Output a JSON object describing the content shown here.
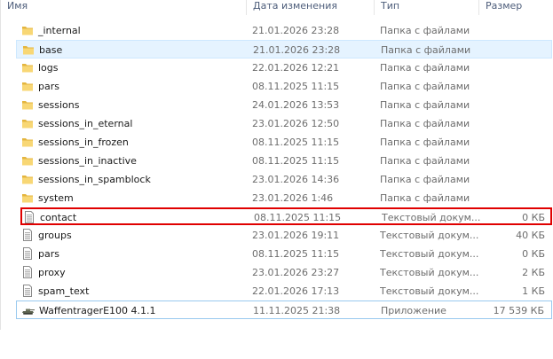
{
  "columns": {
    "name": "Имя",
    "date": "Дата изменения",
    "type": "Тип",
    "size": "Размер"
  },
  "rows": [
    {
      "name": "_internal",
      "date": "21.01.2026 23:28",
      "type": "Папка с файлами",
      "size": "",
      "icon": "folder-icon",
      "state": "normal"
    },
    {
      "name": "base",
      "date": "21.01.2026 23:28",
      "type": "Папка с файлами",
      "size": "",
      "icon": "folder-icon",
      "state": "selected"
    },
    {
      "name": "logs",
      "date": "22.01.2026 12:21",
      "type": "Папка с файлами",
      "size": "",
      "icon": "folder-icon",
      "state": "normal"
    },
    {
      "name": "pars",
      "date": "08.11.2025 11:15",
      "type": "Папка с файлами",
      "size": "",
      "icon": "folder-icon",
      "state": "normal"
    },
    {
      "name": "sessions",
      "date": "24.01.2026 13:53",
      "type": "Папка с файлами",
      "size": "",
      "icon": "folder-icon",
      "state": "normal"
    },
    {
      "name": "sessions_in_eternal",
      "date": "23.01.2026 12:50",
      "type": "Папка с файлами",
      "size": "",
      "icon": "folder-icon",
      "state": "normal"
    },
    {
      "name": "sessions_in_frozen",
      "date": "08.11.2025 11:15",
      "type": "Папка с файлами",
      "size": "",
      "icon": "folder-icon",
      "state": "normal"
    },
    {
      "name": "sessions_in_inactive",
      "date": "08.11.2025 11:15",
      "type": "Папка с файлами",
      "size": "",
      "icon": "folder-icon",
      "state": "normal"
    },
    {
      "name": "sessions_in_spamblock",
      "date": "23.01.2026 14:36",
      "type": "Папка с файлами",
      "size": "",
      "icon": "folder-icon",
      "state": "normal"
    },
    {
      "name": "system",
      "date": "23.01.2026 1:46",
      "type": "Папка с файлами",
      "size": "",
      "icon": "folder-icon",
      "state": "normal"
    },
    {
      "name": "contact",
      "date": "08.11.2025 11:15",
      "type": "Текстовый докум...",
      "size": "0 КБ",
      "icon": "text-file-icon",
      "state": "highlight"
    },
    {
      "name": "groups",
      "date": "23.01.2026 19:11",
      "type": "Текстовый докум...",
      "size": "40 КБ",
      "icon": "text-file-icon",
      "state": "normal"
    },
    {
      "name": "pars",
      "date": "08.11.2025 11:15",
      "type": "Текстовый докум...",
      "size": "0 КБ",
      "icon": "text-file-icon",
      "state": "normal"
    },
    {
      "name": "proxy",
      "date": "23.01.2026 23:27",
      "type": "Текстовый докум...",
      "size": "2 КБ",
      "icon": "text-file-icon",
      "state": "normal"
    },
    {
      "name": "spam_text",
      "date": "22.01.2026 17:13",
      "type": "Текстовый докум...",
      "size": "1 КБ",
      "icon": "text-file-icon",
      "state": "normal"
    },
    {
      "name": "WaffentragerE100 4.1.1",
      "date": "11.11.2025 21:38",
      "type": "Приложение",
      "size": "17 539 КБ",
      "icon": "tank-app-icon",
      "state": "app"
    }
  ],
  "colors": {
    "folder": "#f8d775",
    "folder_dark": "#e4b53e",
    "selected_bg": "#e5f3ff",
    "highlight_border": "#e00000",
    "header_text": "#4d5d7a"
  }
}
